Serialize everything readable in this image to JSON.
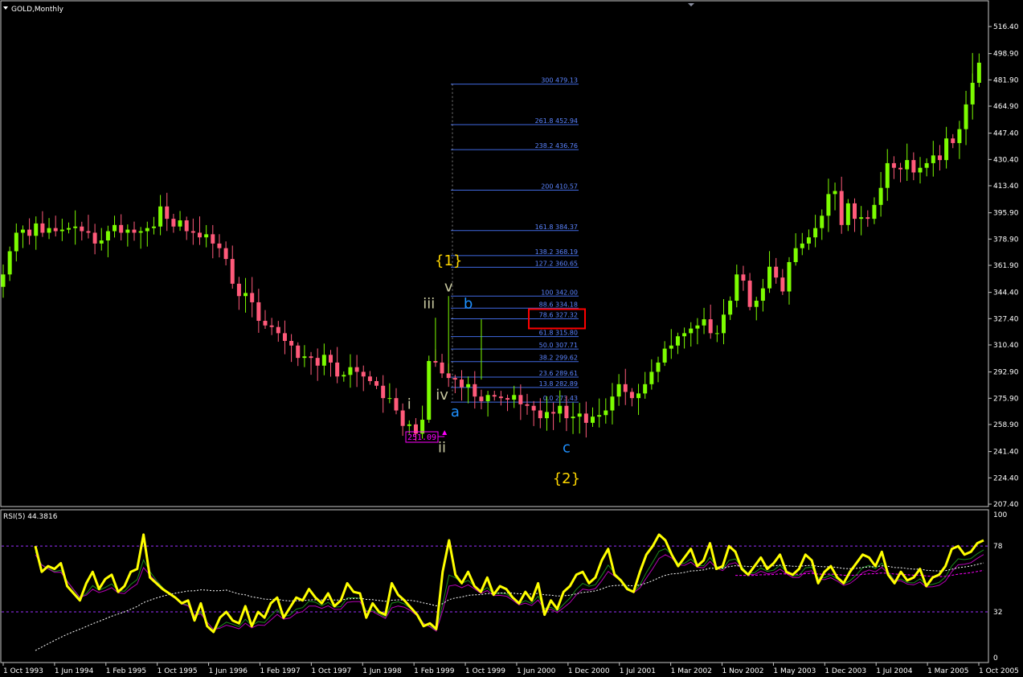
{
  "window": {
    "title": "GOLD,Monthly",
    "indicator_label": "RSI(5) 44.3816"
  },
  "colors": {
    "background": "#000000",
    "frame": "#c8c8c8",
    "bull": "#7cfc00",
    "bear": "#ff5a7a",
    "fib": "#4169e1",
    "fib_text": "#5b84ff",
    "rsi": "#ffff00",
    "rsi_signal1": "#1c8c1c",
    "rsi_signal2": "#b400b4",
    "rsi_ma": "#ffffff",
    "rsi_ma2": "#ff00ff",
    "wave_grey": "#c8c8a0",
    "wave_blue": "#1e90ff",
    "wave_yellow": "#ffd700",
    "highlight_box": "#ff0000",
    "low_label": "#ff00ff"
  },
  "chart_data": [
    {
      "type": "candlestick",
      "title": "GOLD,Monthly",
      "ylim": [
        207.4,
        516.4
      ],
      "y_ticks": [
        "516.40",
        "498.90",
        "481.90",
        "464.90",
        "447.40",
        "430.40",
        "413.40",
        "395.90",
        "378.90",
        "361.90",
        "344.40",
        "327.40",
        "310.40",
        "292.90",
        "275.90",
        "258.90",
        "241.40",
        "224.40",
        "207.40"
      ],
      "x_ticks": [
        "1 Oct 1993",
        "1 Jun 1994",
        "1 Feb 1995",
        "1 Oct 1995",
        "1 Jun 1996",
        "1 Feb 1997",
        "1 Oct 1997",
        "1 Jun 1998",
        "1 Feb 1999",
        "1 Oct 1999",
        "1 Jun 2000",
        "1 Dec 2000",
        "1 Jul 2001",
        "1 Mar 2002",
        "1 Nov 2002",
        "1 May 2003",
        "1 Dec 2003",
        "1 Jul 2004",
        "1 Mar 2005",
        "1 Oct 2005"
      ],
      "close_path": [
        356,
        371,
        383,
        385,
        381,
        389,
        383,
        386,
        384,
        385,
        386,
        387,
        384,
        383,
        376,
        378,
        384,
        388,
        383,
        385,
        383,
        384,
        386,
        387,
        400,
        392,
        387,
        391,
        384,
        383,
        380,
        382,
        376,
        373,
        366,
        350,
        342,
        344,
        338,
        326,
        323,
        322,
        318,
        313,
        310,
        302,
        303,
        302,
        297,
        304,
        299,
        290,
        291,
        296,
        293,
        290,
        287,
        284,
        276,
        276,
        268,
        258,
        259,
        253,
        262,
        300,
        299,
        292,
        289,
        288,
        283,
        285,
        277,
        274,
        278,
        277,
        276,
        275,
        278,
        272,
        271,
        268,
        263,
        267,
        266,
        271,
        263,
        264,
        266,
        260,
        264,
        265,
        268,
        277,
        285,
        280,
        276,
        279,
        285,
        293,
        299,
        308,
        310,
        316,
        318,
        321,
        323,
        327,
        318,
        318,
        330,
        339,
        356,
        352,
        335,
        339,
        347,
        361,
        354,
        345,
        364,
        373,
        376,
        380,
        386,
        394,
        408,
        410,
        388,
        402,
        392,
        393,
        392,
        401,
        412,
        428,
        425,
        424,
        430,
        422,
        425,
        428,
        433,
        430,
        444,
        441,
        450,
        466,
        480,
        493
      ],
      "high_price": 499.3,
      "low_price": 251.09,
      "low_label": "251.09",
      "fibonacci_levels": [
        {
          "label": "300 479.13",
          "price": 479.13
        },
        {
          "label": "261.8 452.94",
          "price": 452.94
        },
        {
          "label": "238.2 436.76",
          "price": 436.76
        },
        {
          "label": "200 410.57",
          "price": 410.57
        },
        {
          "label": "161.8 384.37",
          "price": 384.37
        },
        {
          "label": "138.2 368.19",
          "price": 368.19
        },
        {
          "label": "127.2 360.65",
          "price": 360.65
        },
        {
          "label": "100 342.00",
          "price": 342.0
        },
        {
          "label": "88.6 334.18",
          "price": 334.18
        },
        {
          "label": "78.6 327.32",
          "price": 327.32
        },
        {
          "label": "61.8 315.80",
          "price": 315.8
        },
        {
          "label": "50.0 307.71",
          "price": 307.71
        },
        {
          "label": "38.2 299.62",
          "price": 299.62
        },
        {
          "label": "23.6 289.61",
          "price": 289.61
        },
        {
          "label": "13.8 282.89",
          "price": 282.89
        },
        {
          "label": "0.0 273.43",
          "price": 273.43
        }
      ],
      "highlighted_level": "78.6 327.32",
      "wave_labels": [
        {
          "text": "{1}",
          "color": "yellow",
          "bar": 68,
          "price": 362
        },
        {
          "text": "v",
          "color": "grey",
          "bar": 68,
          "price": 345
        },
        {
          "text": "iii",
          "color": "grey",
          "bar": 65,
          "price": 334
        },
        {
          "text": "b",
          "color": "blue",
          "bar": 71,
          "price": 334
        },
        {
          "text": "i",
          "color": "grey",
          "bar": 62,
          "price": 269
        },
        {
          "text": "iv",
          "color": "grey",
          "bar": 67,
          "price": 275
        },
        {
          "text": "a",
          "color": "blue",
          "bar": 69,
          "price": 264
        },
        {
          "text": "ii",
          "color": "grey",
          "bar": 67,
          "price": 241
        },
        {
          "text": "c",
          "color": "blue",
          "bar": 86,
          "price": 241
        },
        {
          "text": "{2}",
          "color": "yellow",
          "bar": 86,
          "price": 221
        }
      ]
    },
    {
      "type": "line",
      "title": "RSI(5) 44.3816",
      "ylim": [
        0,
        100
      ],
      "y_ticks": [
        "100",
        "78",
        "32",
        "0"
      ],
      "levels": [
        78,
        32
      ],
      "series": [
        {
          "values": [
            78,
            60,
            64,
            62,
            66,
            50,
            45,
            40,
            52,
            60,
            48,
            55,
            58,
            46,
            50,
            60,
            62,
            86,
            56,
            52,
            48,
            45,
            42,
            38,
            40,
            26,
            38,
            22,
            18,
            28,
            32,
            26,
            24,
            36,
            22,
            32,
            28,
            38,
            42,
            28,
            35,
            42,
            40,
            48,
            42,
            38,
            45,
            36,
            40,
            52,
            46,
            45,
            28,
            38,
            32,
            30,
            52,
            44,
            40,
            35,
            30,
            22,
            24,
            20,
            60,
            82,
            58,
            52,
            60,
            50,
            46,
            56,
            44,
            50,
            48,
            42,
            38,
            46,
            40,
            52,
            30,
            40,
            34,
            46,
            50,
            58,
            60,
            52,
            56,
            68,
            76,
            58,
            54,
            48,
            46,
            60,
            72,
            78,
            86,
            82,
            72,
            64,
            70,
            76,
            64,
            68,
            80,
            62,
            64,
            78,
            74,
            62,
            58,
            64,
            70,
            62,
            66,
            72,
            60,
            58,
            62,
            72,
            68,
            52,
            60,
            64,
            56,
            52,
            60,
            66,
            72,
            70,
            64,
            74,
            58,
            52,
            60,
            54,
            56,
            62,
            50,
            56,
            58,
            64,
            76,
            78,
            72,
            74,
            80,
            82
          ]
        }
      ]
    }
  ]
}
